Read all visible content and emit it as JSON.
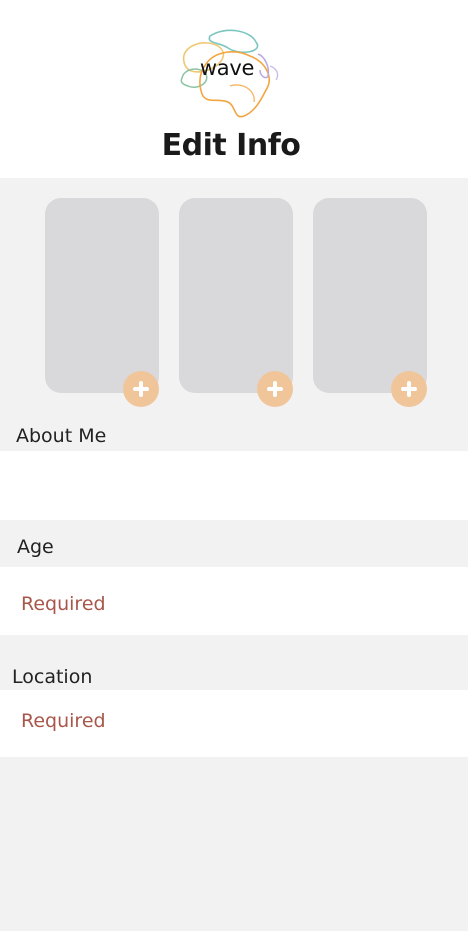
{
  "header": {
    "logo_text": "wave",
    "title": "Edit Info"
  },
  "photos": {
    "slots": [
      {
        "add_icon": "plus-icon"
      },
      {
        "add_icon": "plus-icon"
      },
      {
        "add_icon": "plus-icon"
      }
    ],
    "accent_color": "#f1c59a"
  },
  "about": {
    "label": "About Me",
    "value": ""
  },
  "age": {
    "label": "Age",
    "value": "Required"
  },
  "location": {
    "label": "Location",
    "value": "Required"
  },
  "colors": {
    "required_text": "#a9574b",
    "background": "#f2f2f3"
  }
}
